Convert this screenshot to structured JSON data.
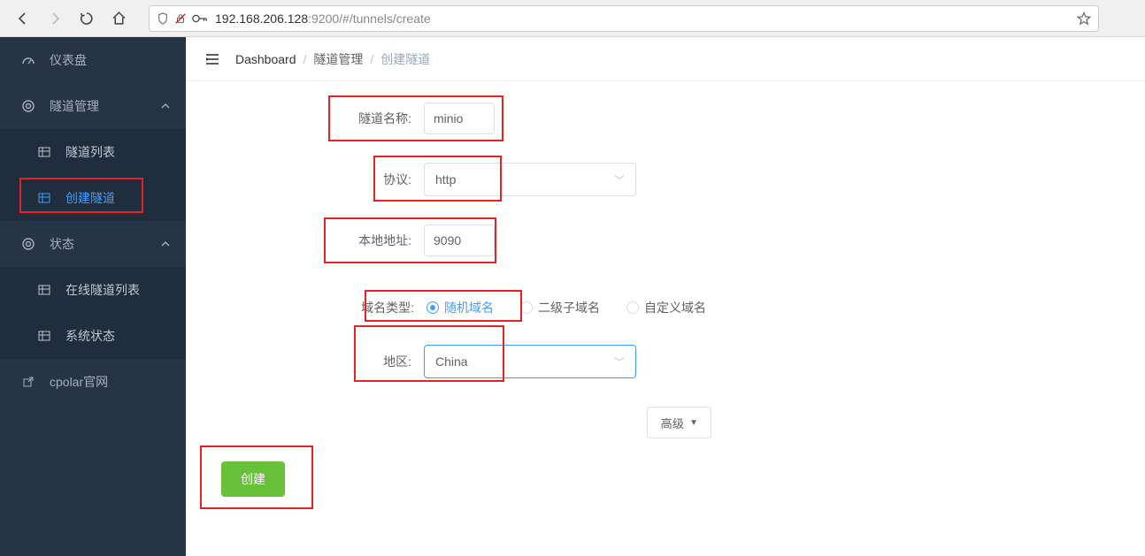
{
  "browser": {
    "url_prefix": "192.168.206.128",
    "url_suffix": ":9200/#/tunnels/create"
  },
  "sidebar": {
    "items": [
      {
        "label": "仪表盘"
      },
      {
        "label": "隧道管理"
      },
      {
        "label": "隧道列表"
      },
      {
        "label": "创建隧道"
      },
      {
        "label": "状态"
      },
      {
        "label": "在线隧道列表"
      },
      {
        "label": "系统状态"
      },
      {
        "label": "cpolar官网"
      }
    ]
  },
  "breadcrumb": {
    "items": [
      "Dashboard",
      "隧道管理",
      "创建隧道"
    ]
  },
  "form": {
    "tunnel_name_label": "隧道名称:",
    "tunnel_name_value": "minio",
    "protocol_label": "协议:",
    "protocol_value": "http",
    "local_addr_label": "本地地址:",
    "local_addr_value": "9090",
    "domain_type_label": "域名类型:",
    "domain_type_options": [
      "随机域名",
      "二级子域名",
      "自定义域名"
    ],
    "region_label": "地区:",
    "region_value": "China",
    "advanced_label": "高级",
    "submit_label": "创建"
  }
}
